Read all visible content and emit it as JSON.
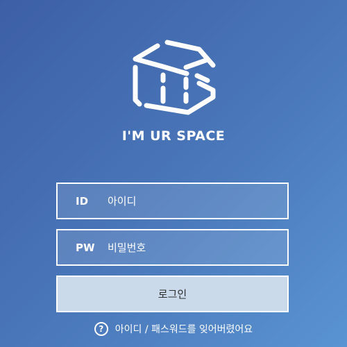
{
  "brand": {
    "name": "I'M UR SPACE",
    "logo_icon": "cube-s-logo-icon"
  },
  "login_form": {
    "id_label": "ID",
    "id_placeholder": "아이디",
    "id_value": "",
    "pw_label": "PW",
    "pw_placeholder": "비밀번호",
    "pw_value": "",
    "submit_label": "로그인"
  },
  "help": {
    "icon": "question-circle-icon",
    "icon_glyph": "?",
    "forgot_label": "아이디 / 패스워드를 잊어버렸어요"
  },
  "colors": {
    "background_start": "#3d5fa6",
    "background_end": "#5a94d2",
    "button_fill": "#cbdaeb",
    "text_light": "#ffffff"
  }
}
